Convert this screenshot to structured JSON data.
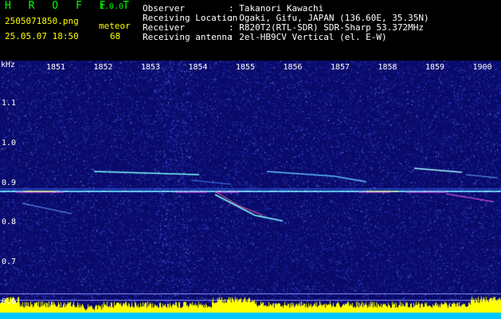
{
  "header": {
    "brand": "H R O F F T",
    "version": "1.0.0",
    "filename": "2505071850.png",
    "datetime": "25.05.07 18:50",
    "mode_label": "meteor",
    "count": "68",
    "fields": [
      {
        "label": "Observer",
        "value": ": Takanori Kawachi"
      },
      {
        "label": "Receiving Location",
        "value": ": Ogaki, Gifu, JAPAN (136.60E, 35.35N)"
      },
      {
        "label": "Receiver",
        "value": ": R820T2(RTL-SDR) SDR-Sharp 53.372MHz"
      },
      {
        "label": "Receiving antenna",
        "value": ": 2el-HB9CV Vertical (el. E-W)"
      }
    ]
  },
  "axes": {
    "y_unit": "kHz",
    "y_ticks": [
      "1.1",
      "1.0",
      "0.9",
      "0.8",
      "0.7",
      "0.6"
    ],
    "y_values": [
      1.1,
      1.0,
      0.9,
      0.8,
      0.7,
      0.6
    ],
    "x_ticks": [
      "1851",
      "1852",
      "1853",
      "1854",
      "1855",
      "1856",
      "1857",
      "1858",
      "1859",
      "1900"
    ]
  },
  "colors": {
    "background": "#000000",
    "spectrogram_bg": "#0a0a6a",
    "noise": "#3050ff",
    "carrier": "#80ffff",
    "level_bar": "#ffff00",
    "level_base": "#00c8ff",
    "header_green": "#00ff00",
    "header_yellow": "#ffff00"
  }
}
